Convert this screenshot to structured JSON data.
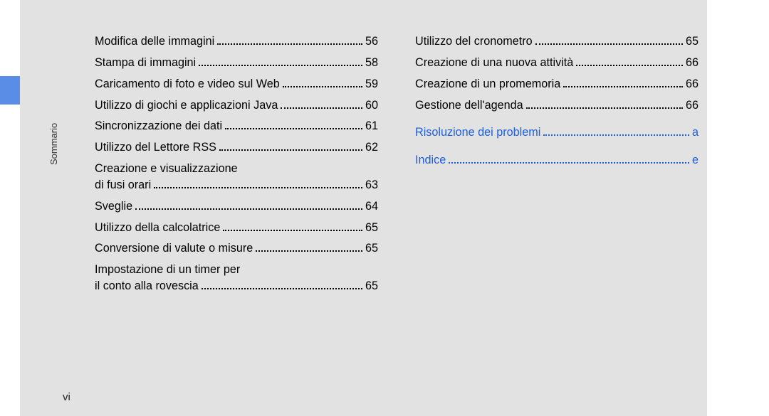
{
  "side_label": "Sommario",
  "page_number": "vi",
  "left_column": [
    {
      "label": "Modifica delle immagini",
      "page": "56",
      "wrap": false
    },
    {
      "label": "Stampa di immagini",
      "page": "58",
      "wrap": false
    },
    {
      "label": "Caricamento di foto e video sul Web",
      "page": "59",
      "wrap": false
    },
    {
      "label": "Utilizzo di giochi e applicazioni Java",
      "page": "60",
      "wrap": false
    },
    {
      "label": "Sincronizzazione dei dati",
      "page": "61",
      "wrap": false
    },
    {
      "label": "Utilizzo del Lettore RSS",
      "page": "62",
      "wrap": false
    },
    {
      "label": "Creazione e visualizzazione",
      "cont": "di fusi orari",
      "page": "63",
      "wrap": true
    },
    {
      "label": "Sveglie",
      "page": "64",
      "wrap": false
    },
    {
      "label": "Utilizzo della calcolatrice",
      "page": "65",
      "wrap": false
    },
    {
      "label": "Conversione di valute o misure",
      "page": "65",
      "wrap": false
    },
    {
      "label": "Impostazione di un timer per",
      "cont": "il conto alla rovescia",
      "page": "65",
      "wrap": true
    }
  ],
  "right_column": [
    {
      "label": "Utilizzo del cronometro",
      "page": "65",
      "link": false
    },
    {
      "label": "Creazione di una nuova attività",
      "page": "66",
      "link": false
    },
    {
      "label": "Creazione di un promemoria",
      "page": "66",
      "link": false
    },
    {
      "label": "Gestione dell'agenda",
      "page": "66",
      "link": false
    },
    {
      "label": "Risoluzione dei problemi",
      "page": "a",
      "link": true
    },
    {
      "label": "Indice",
      "page": "e",
      "link": true
    }
  ]
}
